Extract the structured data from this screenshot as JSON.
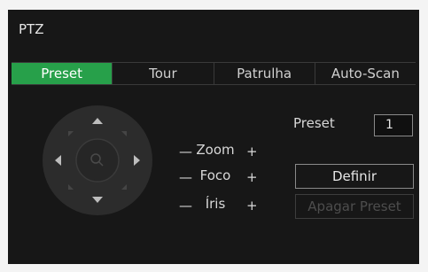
{
  "window": {
    "title": "PTZ"
  },
  "tabs": [
    {
      "label": "Preset",
      "active": true
    },
    {
      "label": "Tour",
      "active": false
    },
    {
      "label": "Patrulha",
      "active": false
    },
    {
      "label": "Auto-Scan",
      "active": false
    }
  ],
  "controls": {
    "minus": "—",
    "plus": "+",
    "zoom_label": "Zoom",
    "focus_label": "Foco",
    "iris_label": "Íris"
  },
  "preset": {
    "label": "Preset",
    "value": "1",
    "define_label": "Definir",
    "delete_label": "Apagar Preset"
  },
  "colors": {
    "active_tab": "#27a04a",
    "panel_bg": "#171717"
  },
  "icons": {
    "joystick": "ptz-direction-pad",
    "center": "magnifier-icon"
  }
}
